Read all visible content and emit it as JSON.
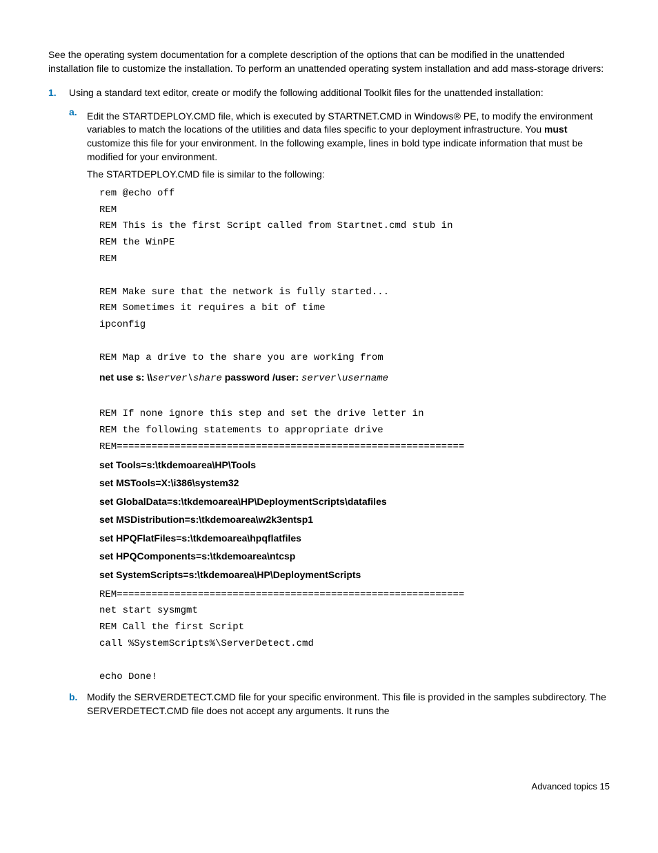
{
  "intro": "See the operating system documentation for a complete description of the options that can be modified in the unattended installation file to customize the installation. To perform an unattended operating system installation and add mass-storage drivers:",
  "step1": {
    "num": "1.",
    "text": "Using a standard text editor, create or modify the following additional Toolkit files for the unattended installation:",
    "a": {
      "num": "a.",
      "p1_prefix": "Edit the STARTDEPLOY.CMD file, which is executed by STARTNET.CMD in Windows® PE, to modify the environment variables to match the locations of the utilities and data files specific to your deployment infrastructure. You ",
      "p1_bold": "must",
      "p1_suffix": " customize this file for your environment. In the following example, lines in bold type indicate information that must be modified for your environment.",
      "p2": "The STARTDEPLOY.CMD file is similar to the following:",
      "code1": "rem @echo off\nREM\nREM This is the first Script called from Startnet.cmd stub in\nREM the WinPE\nREM\n\nREM Make sure that the network is fully started...\nREM Sometimes it requires a bit of time\nipconfig\n\nREM Map a drive to the share you are working from\n",
      "netuse_bold1": "net use s: \\\\",
      "netuse_ital1": "server\\share",
      "netuse_bold2": " password /user: ",
      "netuse_ital2": "server\\username",
      "code2": "\nREM If none ignore this step and set the drive letter in\nREM the following statements to appropriate drive\nREM============================================================",
      "setlines": "set Tools=s:\\tkdemoarea\\HP\\Tools\nset MSTools=X:\\i386\\system32\nset GlobalData=s:\\tkdemoarea\\HP\\DeploymentScripts\\datafiles\nset MSDistribution=s:\\tkdemoarea\\w2k3entsp1\nset HPQFlatFiles=s:\\tkdemoarea\\hpqflatfiles\nset HPQComponents=s:\\tkdemoarea\\ntcsp\nset SystemScripts=s:\\tkdemoarea\\HP\\DeploymentScripts",
      "code3": "REM============================================================\nnet start sysmgmt\nREM Call the first Script\ncall %SystemScripts%\\ServerDetect.cmd\n\necho Done!"
    },
    "b": {
      "num": "b.",
      "text": "Modify the SERVERDETECT.CMD file for your specific environment. This file is provided in the samples subdirectory. The SERVERDETECT.CMD file does not accept any arguments. It runs the"
    }
  },
  "footer": "Advanced topics   15"
}
